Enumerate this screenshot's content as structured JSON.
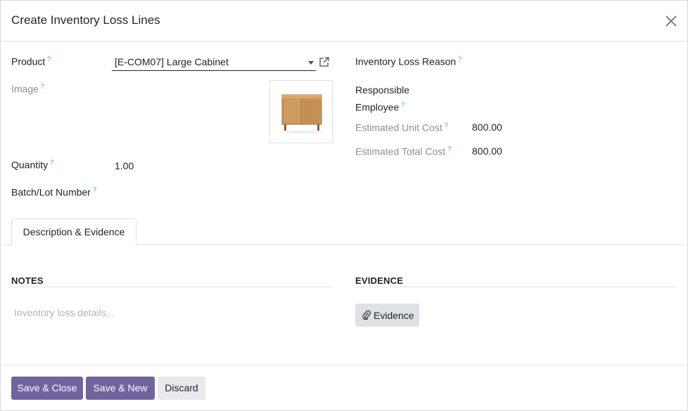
{
  "dialog": {
    "title": "Create Inventory Loss Lines",
    "close_icon": "close-icon"
  },
  "form": {
    "help_marker": "?",
    "product": {
      "label": "Product",
      "value": "[E-COM07] Large Cabinet"
    },
    "image": {
      "label": "Image",
      "depicts": "wooden cabinet"
    },
    "quantity": {
      "label": "Quantity",
      "value": "1.00"
    },
    "batch_lot": {
      "label": "Batch/Lot Number",
      "value": ""
    },
    "loss_reason": {
      "label": "Inventory Loss Reason",
      "value": ""
    },
    "responsible": {
      "label_line1": "Responsible",
      "label_line2": "Employee",
      "value": ""
    },
    "unit_cost": {
      "label": "Estimated Unit Cost",
      "value": "800.00"
    },
    "total_cost": {
      "label": "Estimated Total Cost",
      "value": "800.00"
    }
  },
  "tabs": [
    {
      "label": "Description & Evidence",
      "active": true
    }
  ],
  "notes": {
    "title": "NOTES",
    "placeholder": "Inventory loss details..."
  },
  "evidence": {
    "title": "EVIDENCE",
    "button_label": "Evidence",
    "icon": "paperclip-icon"
  },
  "footer": {
    "save_close": "Save & Close",
    "save_new": "Save & New",
    "discard": "Discard"
  },
  "colors": {
    "primary": "#71639e",
    "help": "#3aa1c9"
  }
}
